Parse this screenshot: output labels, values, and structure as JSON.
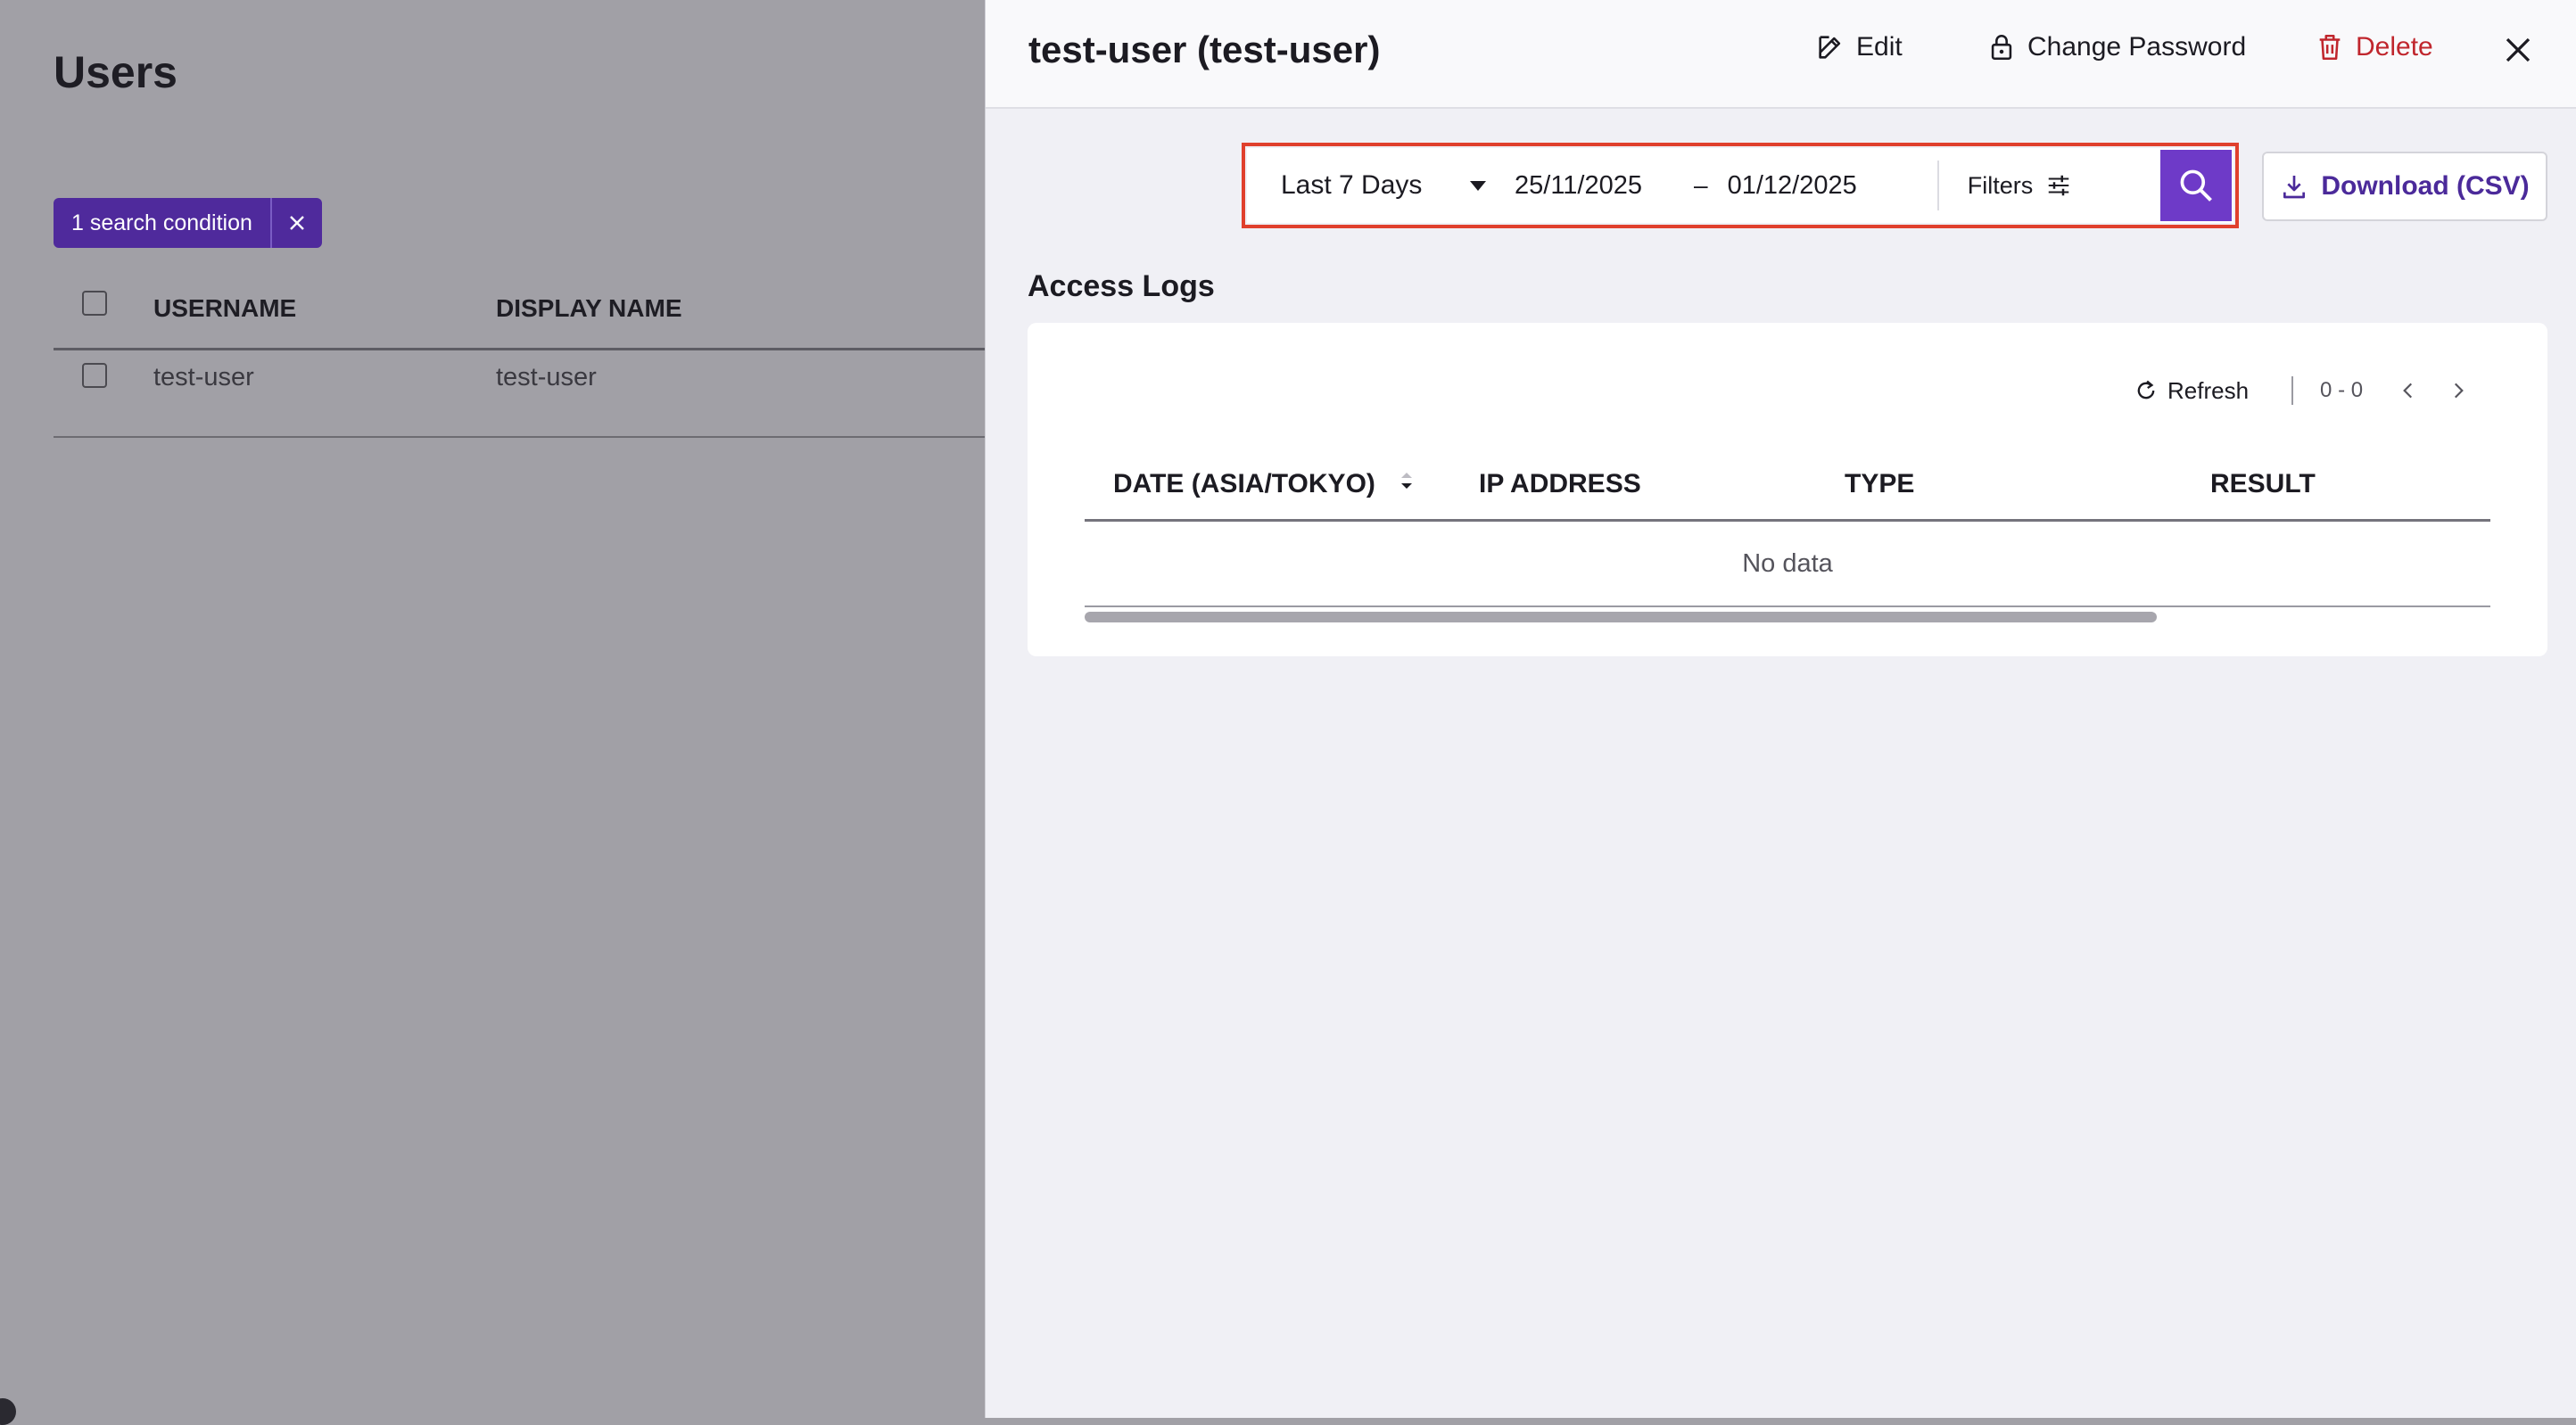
{
  "background": {
    "title": "Users",
    "chip": {
      "label": "1 search condition"
    },
    "table": {
      "columns": [
        "USERNAME",
        "DISPLAY NAME"
      ],
      "rows": [
        {
          "username": "test-user",
          "display_name": "test-user"
        }
      ]
    }
  },
  "drawer": {
    "title": "test-user (test-user)",
    "actions": {
      "edit": "Edit",
      "change_password": "Change Password",
      "delete": "Delete"
    },
    "filter": {
      "period": "Last 7 Days",
      "date_from": "25/11/2025",
      "separator": "–",
      "date_to": "01/12/2025",
      "filters_label": "Filters"
    },
    "download_label": "Download (CSV)",
    "section_title": "Access Logs",
    "logs": {
      "refresh_label": "Refresh",
      "page_range": "0 - 0",
      "columns": [
        "DATE (ASIA/TOKYO)",
        "IP ADDRESS",
        "TYPE",
        "RESULT"
      ],
      "empty_text": "No data"
    }
  },
  "colors": {
    "accent": "#6e3ac8",
    "chip": "#4f2a9c",
    "danger": "#c0262d",
    "highlight": "#e0402d"
  },
  "icons": [
    "close-icon",
    "edit-icon",
    "lock-icon",
    "trash-icon",
    "caret-down-icon",
    "filter-sliders-icon",
    "search-icon",
    "download-icon",
    "refresh-icon",
    "sort-icon",
    "chevron-left-icon",
    "chevron-right-icon"
  ]
}
